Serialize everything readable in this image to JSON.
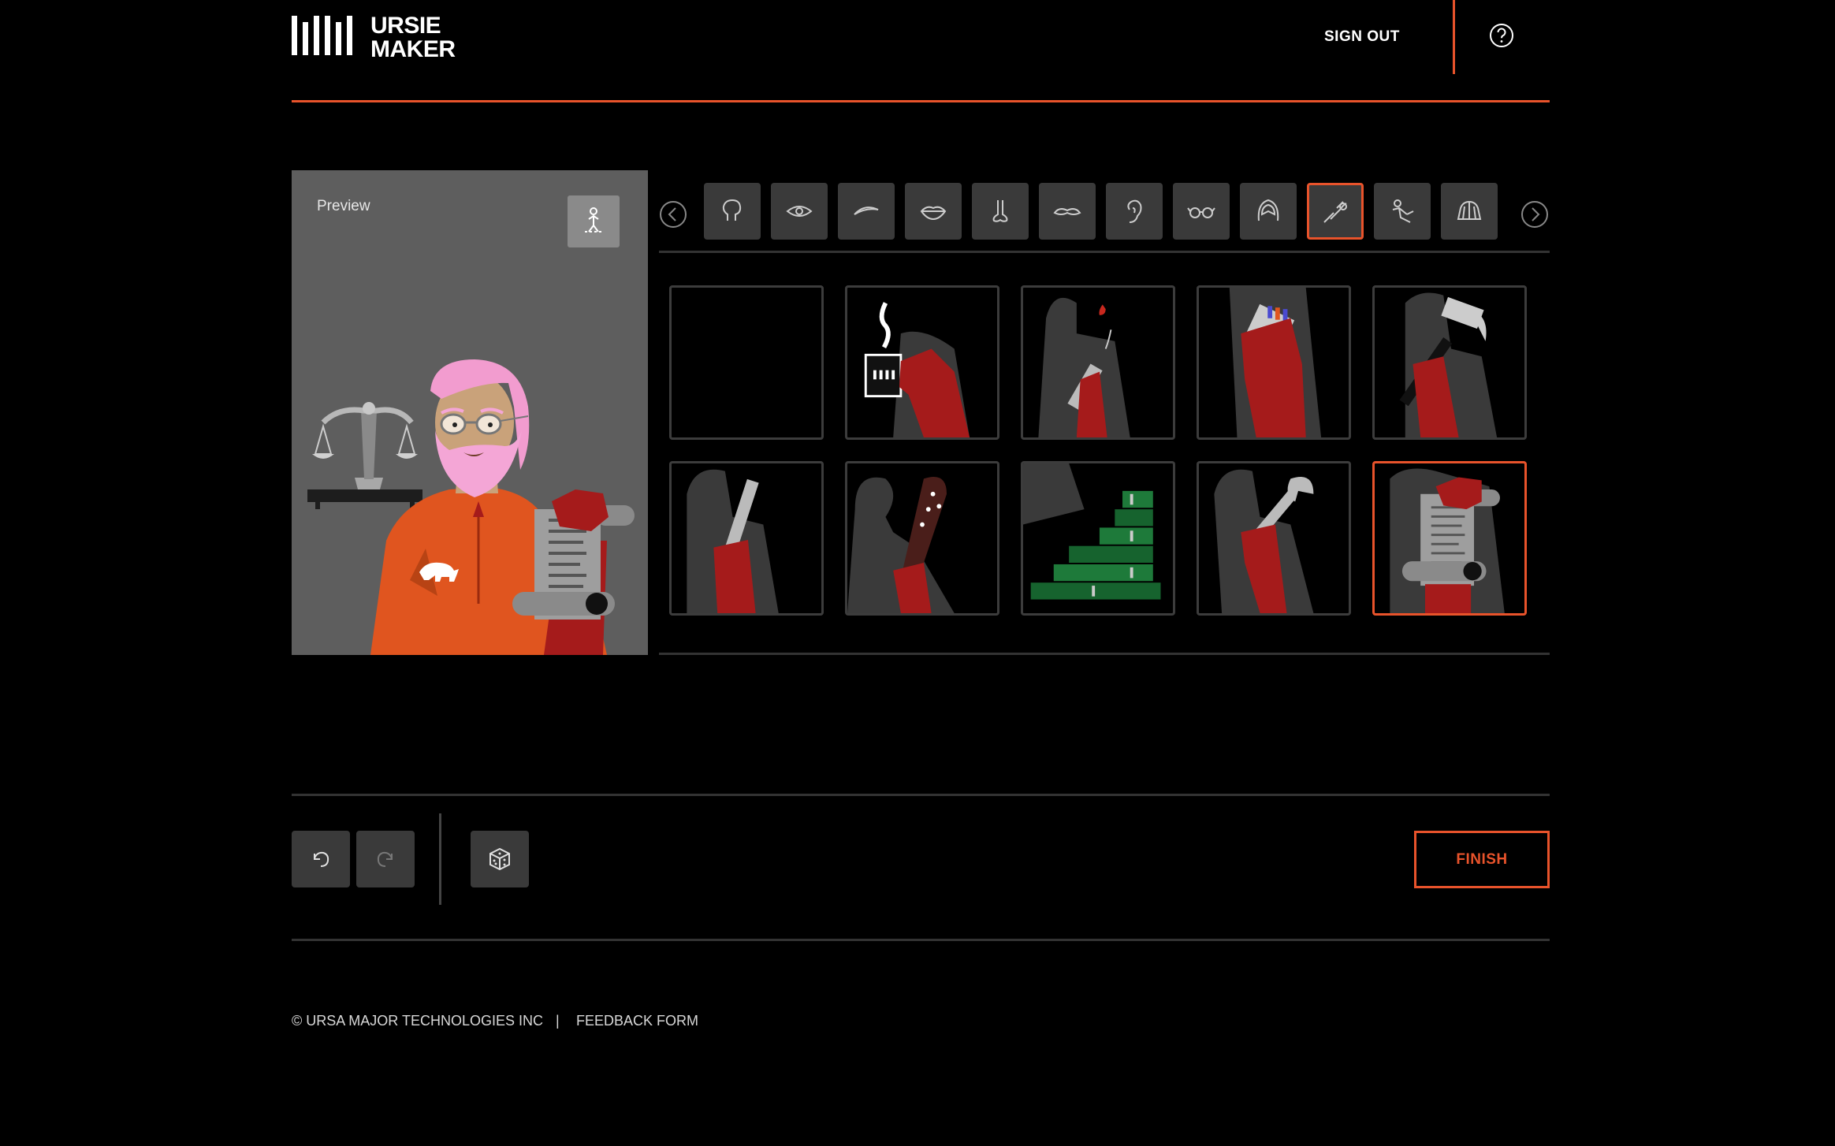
{
  "header": {
    "logo_line1": "URSIE",
    "logo_line2": "MAKER",
    "sign_out": "SIGN OUT",
    "help_icon": "question-circle-icon"
  },
  "preview": {
    "label": "Preview",
    "pose_icon": "pose-figure-icon"
  },
  "categories": {
    "prev_icon": "chevron-left-icon",
    "next_icon": "chevron-right-icon",
    "items": [
      {
        "name": "head-shape",
        "icon": "head-icon"
      },
      {
        "name": "eyes",
        "icon": "eye-icon"
      },
      {
        "name": "eyebrows",
        "icon": "eyebrow-icon"
      },
      {
        "name": "mouth",
        "icon": "lips-icon"
      },
      {
        "name": "nose",
        "icon": "nose-icon"
      },
      {
        "name": "mustache",
        "icon": "mustache-icon"
      },
      {
        "name": "ears",
        "icon": "ear-icon"
      },
      {
        "name": "glasses",
        "icon": "glasses-icon"
      },
      {
        "name": "hair",
        "icon": "hair-icon"
      },
      {
        "name": "held-item",
        "icon": "hand-item-icon",
        "active": true
      },
      {
        "name": "background-item",
        "icon": "figure-item-icon"
      },
      {
        "name": "hat",
        "icon": "hat-icon"
      }
    ]
  },
  "options": [
    {
      "name": "none",
      "selected": false
    },
    {
      "name": "coffee-mug",
      "selected": false
    },
    {
      "name": "dripping-syringe",
      "selected": false
    },
    {
      "name": "matchbox",
      "selected": false
    },
    {
      "name": "hammer",
      "selected": false
    },
    {
      "name": "ruler",
      "selected": false
    },
    {
      "name": "spiked-club",
      "selected": false
    },
    {
      "name": "cash-stacks",
      "selected": false
    },
    {
      "name": "wrench",
      "selected": false
    },
    {
      "name": "scroll",
      "selected": true
    }
  ],
  "toolbar": {
    "undo_icon": "undo-icon",
    "redo_icon": "redo-icon",
    "randomize_icon": "dice-icon",
    "finish": "FINISH"
  },
  "footer": {
    "copyright": "© URSA MAJOR TECHNOLOGIES INC",
    "separator": "|",
    "feedback": "FEEDBACK FORM"
  },
  "colors": {
    "accent": "#e8532b",
    "background": "#000000",
    "tile": "#3a3a3a",
    "arm_red": "#a51b1b",
    "jacket_orange": "#e0551f"
  }
}
